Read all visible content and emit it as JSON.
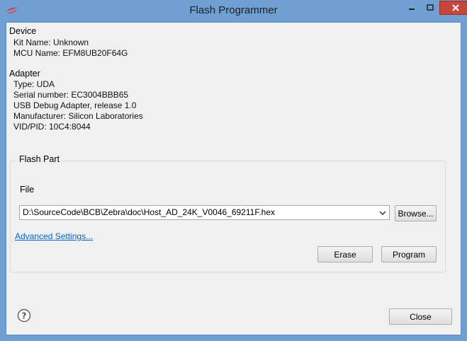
{
  "window": {
    "title": "Flash Programmer"
  },
  "device": {
    "heading": "Device",
    "kit_name": "Kit Name: Unknown",
    "mcu_name": "MCU Name: EFM8UB20F64G"
  },
  "adapter": {
    "heading": "Adapter",
    "type": "Type: UDA",
    "serial": "Serial number: EC3004BBB65",
    "usb": "USB Debug Adapter, release 1.0",
    "manufacturer": "Manufacturer: Silicon Laboratories",
    "vidpid": "VID/PID: 10C4:8044"
  },
  "flash_part": {
    "title": "Flash Part",
    "file_label": "File",
    "file_value": "D:\\SourceCode\\BCB\\Zebra\\doc\\Host_AD_24K_V0046_69211F.hex",
    "browse_label": "Browse...",
    "advanced_label": "Advanced Settings...",
    "erase_label": "Erase",
    "program_label": "Program"
  },
  "footer": {
    "close_label": "Close"
  },
  "icons": {
    "app": "silabs-logo-icon",
    "help": "help-icon"
  },
  "colors": {
    "titlebar": "#6f9fd3",
    "close_button": "#c7463b",
    "link": "#0066cc"
  }
}
